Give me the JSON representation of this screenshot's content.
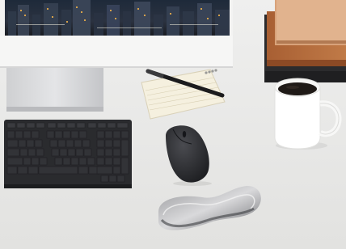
{
  "scene": {
    "kind": "photo",
    "objects": [
      "monitor",
      "monitor-stand",
      "keyboard",
      "notepad",
      "pen",
      "mouse",
      "wrist-rest",
      "coffee-mug",
      "book-stack"
    ]
  },
  "colors": {
    "desk": "#e6e6e4",
    "monitor_bezel": "#f3f3f2",
    "keyboard": "#2a2b2e",
    "mouse": "#2b2c2f",
    "mug": "#ffffff",
    "coffee": "#1f1a17",
    "books_brown": "#b46b3a",
    "notepad": "#f5f0df"
  }
}
